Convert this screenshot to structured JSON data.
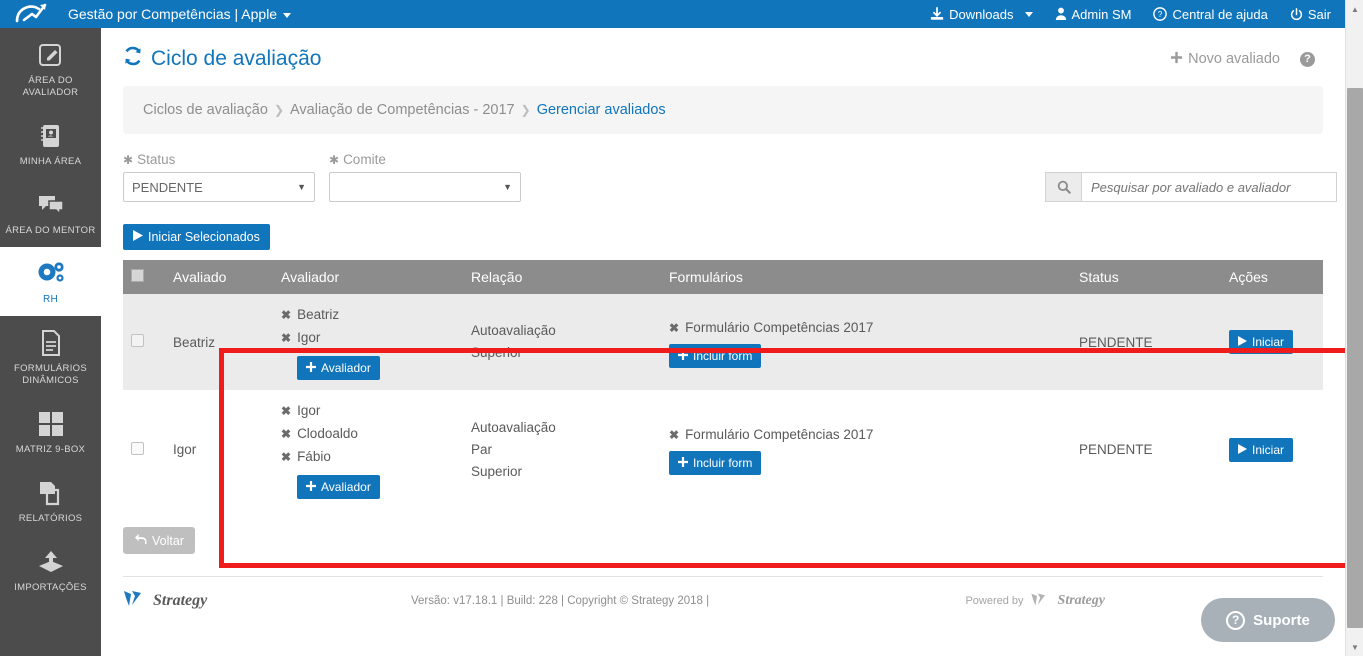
{
  "topbar": {
    "brand": "Gestão por Competências | Apple",
    "logo_icon": "check-arrow-logo",
    "items": [
      {
        "label": "Downloads",
        "icon": "download-icon",
        "caret": true
      },
      {
        "label": "Admin SM",
        "icon": "user-icon",
        "caret": false
      },
      {
        "label": "Central de ajuda",
        "icon": "question-circle-icon",
        "caret": false
      },
      {
        "label": "Sair",
        "icon": "power-icon",
        "caret": false
      }
    ]
  },
  "sidebar": {
    "items": [
      {
        "label": "ÁREA DO AVALIADOR",
        "icon": "pencil-square-icon",
        "active": false
      },
      {
        "label": "MINHA ÁREA",
        "icon": "notebook-icon",
        "active": false
      },
      {
        "label": "ÁREA DO MENTOR",
        "icon": "chat-bubbles-icon",
        "active": false
      },
      {
        "label": "RH",
        "icon": "gears-icon",
        "active": true
      },
      {
        "label": "FORMULÁRIOS DINÂMICOS",
        "icon": "document-icon",
        "active": false
      },
      {
        "label": "MATRIZ 9-BOX",
        "icon": "grid-squares-icon",
        "active": false
      },
      {
        "label": "RELATÓRIOS",
        "icon": "copy-pages-icon",
        "active": false
      },
      {
        "label": "IMPORTAÇÕES",
        "icon": "upload-icon",
        "active": false
      }
    ]
  },
  "page": {
    "title": "Ciclo de avaliação",
    "title_icon": "refresh-cycle-icon",
    "new_button": "Novo avaliado",
    "new_button_icon": "plus-icon",
    "help_icon": "question-mark-icon"
  },
  "breadcrumb": {
    "items": [
      {
        "label": "Ciclos de avaliação",
        "current": false
      },
      {
        "label": "Avaliação de Competências - 2017",
        "current": false
      },
      {
        "label": "Gerenciar avaliados",
        "current": true
      }
    ],
    "separator": "❯"
  },
  "filters": {
    "status": {
      "label": "Status",
      "value": "PENDENTE",
      "icon": "asterisk-icon"
    },
    "comite": {
      "label": "Comite",
      "value": "",
      "icon": "asterisk-icon"
    },
    "search": {
      "placeholder": "Pesquisar por avaliado e avaliador",
      "value": "",
      "icon": "search-icon"
    }
  },
  "toolbar": {
    "start_selected": "Iniciar Selecionados",
    "start_selected_icon": "play-icon"
  },
  "table": {
    "columns": [
      "",
      "Avaliado",
      "Avaliador",
      "Relação",
      "Formulários",
      "Status",
      "Ações"
    ],
    "rows": [
      {
        "avaliado": "Beatriz",
        "avaliadores": [
          "Beatriz",
          "Igor"
        ],
        "add_avaliador_label": "Avaliador",
        "relacoes": [
          "Autoavaliação",
          "Superior"
        ],
        "formularios": [
          "Formulário Competências 2017"
        ],
        "add_form_label": "Incluir form",
        "status": "PENDENTE",
        "action_label": "Iniciar"
      },
      {
        "avaliado": "Igor",
        "avaliadores": [
          "Igor",
          "Clodoaldo",
          "Fábio"
        ],
        "add_avaliador_label": "Avaliador",
        "relacoes": [
          "Autoavaliação",
          "Par",
          "Superior"
        ],
        "formularios": [
          "Formulário Competências 2017"
        ],
        "add_form_label": "Incluir form",
        "status": "PENDENTE",
        "action_label": "Iniciar"
      }
    ]
  },
  "footer": {
    "back_button": "Voltar",
    "back_icon": "arrow-back-icon",
    "logo_text": "Strategy",
    "version": "Versão: v17.18.1 | Build: 228 | Copyright © Strategy 2018 |",
    "powered_by": "Powered by",
    "powered_logo_text": "Strategy",
    "support_button": "Suporte",
    "support_icon": "question-circle-icon"
  },
  "colors": {
    "brand_blue": "#1175bc",
    "sidebar_dark": "#4c4c4c",
    "table_header_grey": "#8c8c8c",
    "highlight_red": "#f01c1c",
    "row_alt": "#ebebeb"
  },
  "highlight": {
    "present": true,
    "color": "#f01c1c"
  }
}
